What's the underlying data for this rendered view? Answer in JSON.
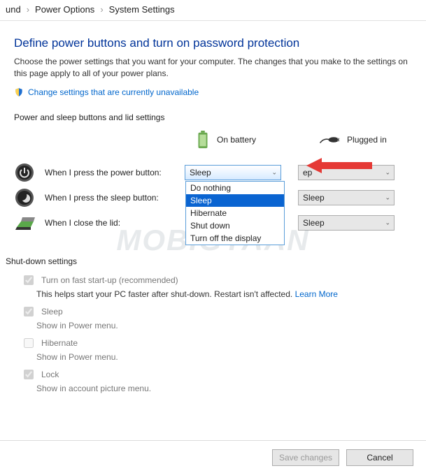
{
  "breadcrumb": {
    "item1": "und",
    "item2": "Power Options",
    "item3": "System Settings"
  },
  "title": "Define power buttons and turn on password protection",
  "description": "Choose the power settings that you want for your computer. The changes that you make to the settings on this page apply to all of your power plans.",
  "unavailable_link": "Change settings that are currently unavailable",
  "section_header": "Power and sleep buttons and lid settings",
  "columns": {
    "battery": "On battery",
    "plugged": "Plugged in"
  },
  "rows": {
    "power": {
      "label": "When I press the power button:",
      "battery_value": "Sleep",
      "plugged_value": "ep",
      "options": [
        "Do nothing",
        "Sleep",
        "Hibernate",
        "Shut down",
        "Turn off the display"
      ]
    },
    "sleep": {
      "label": "When I press the sleep button:",
      "plugged_value": "Sleep"
    },
    "lid": {
      "label": "When I close the lid:",
      "plugged_value": "Sleep"
    }
  },
  "shutdown": {
    "header": "Shut-down settings",
    "fast_startup": {
      "label": "Turn on fast start-up (recommended)",
      "note": "This helps start your PC faster after shut-down. Restart isn't affected.",
      "learn_more": "Learn More",
      "checked": true
    },
    "sleep": {
      "label": "Sleep",
      "note": "Show in Power menu.",
      "checked": true
    },
    "hibernate": {
      "label": "Hibernate",
      "note": "Show in Power menu.",
      "checked": false
    },
    "lock": {
      "label": "Lock",
      "note": "Show in account picture menu.",
      "checked": true
    }
  },
  "footer": {
    "save": "Save changes",
    "cancel": "Cancel"
  },
  "watermark": "MOBIGYAAN"
}
